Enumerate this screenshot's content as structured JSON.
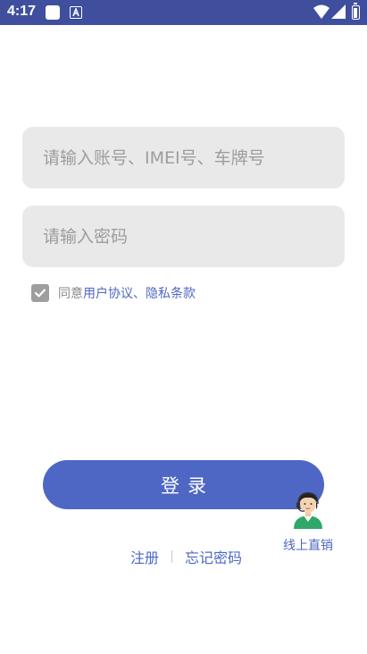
{
  "status_bar": {
    "time": "4:17",
    "background_color": "#3f4f9e",
    "icons": [
      "app-square-icon",
      "app-a-icon",
      "wifi-icon",
      "signal-icon",
      "battery-icon"
    ]
  },
  "login_form": {
    "account_placeholder": "请输入账号、IMEI号、车牌号",
    "account_value": "",
    "password_placeholder": "请输入密码",
    "password_value": ""
  },
  "agreement": {
    "checked": true,
    "prefix": "同意",
    "user_agreement_link": "用户协议",
    "separator": "、",
    "privacy_link": "隐私条款"
  },
  "login_button": {
    "label": "登录"
  },
  "links": {
    "register": "注册",
    "forgot_password": "忘记密码"
  },
  "direct_sales": {
    "label": "线上直销",
    "icon": "customer-service-agent-icon"
  },
  "colors": {
    "accent": "#4e67c4",
    "input_background": "#e9e9e9",
    "placeholder": "#9d9d9d"
  }
}
